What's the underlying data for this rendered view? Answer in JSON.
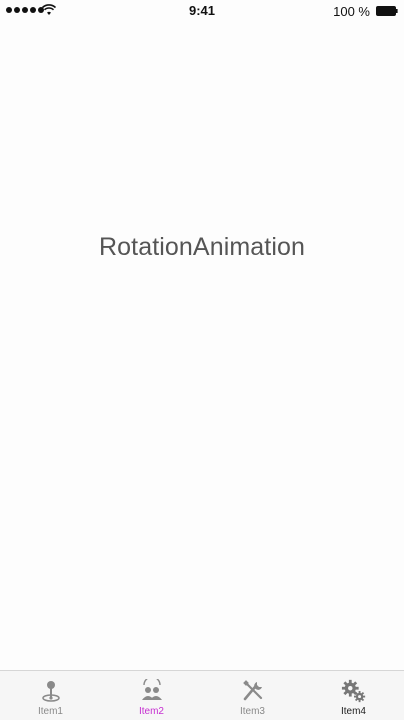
{
  "status_bar": {
    "time": "9:41",
    "battery_percent": "100 %"
  },
  "main": {
    "title": "RotationAnimation"
  },
  "tab_bar": {
    "items": [
      {
        "label": "Item1",
        "icon": "joystick-icon"
      },
      {
        "label": "Item2",
        "icon": "people-icon"
      },
      {
        "label": "Item3",
        "icon": "tools-icon"
      },
      {
        "label": "Item4",
        "icon": "gears-icon"
      }
    ],
    "active_index": 1,
    "active_color": "#c62fd1",
    "inactive_color": "#8a8a8a"
  }
}
